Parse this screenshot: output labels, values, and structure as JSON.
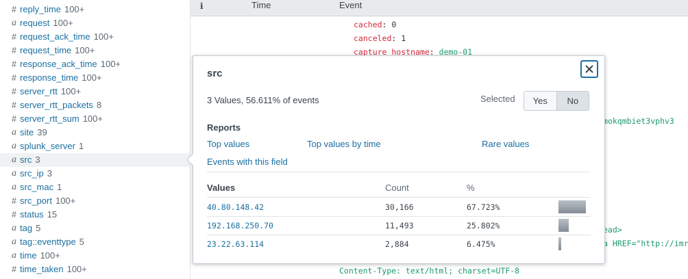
{
  "sidebar": {
    "fields": [
      {
        "type": "#",
        "name": "reply_time",
        "count": "100+"
      },
      {
        "type": "a",
        "name": "request",
        "count": "100+"
      },
      {
        "type": "#",
        "name": "request_ack_time",
        "count": "100+"
      },
      {
        "type": "#",
        "name": "request_time",
        "count": "100+"
      },
      {
        "type": "#",
        "name": "response_ack_time",
        "count": "100+"
      },
      {
        "type": "#",
        "name": "response_time",
        "count": "100+"
      },
      {
        "type": "#",
        "name": "server_rtt",
        "count": "100+"
      },
      {
        "type": "#",
        "name": "server_rtt_packets",
        "count": "8"
      },
      {
        "type": "#",
        "name": "server_rtt_sum",
        "count": "100+"
      },
      {
        "type": "a",
        "name": "site",
        "count": "39"
      },
      {
        "type": "a",
        "name": "splunk_server",
        "count": "1"
      },
      {
        "type": "a",
        "name": "src",
        "count": "3",
        "selected": true
      },
      {
        "type": "a",
        "name": "src_ip",
        "count": "3"
      },
      {
        "type": "a",
        "name": "src_mac",
        "count": "1"
      },
      {
        "type": "#",
        "name": "src_port",
        "count": "100+"
      },
      {
        "type": "#",
        "name": "status",
        "count": "15"
      },
      {
        "type": "a",
        "name": "tag",
        "count": "5"
      },
      {
        "type": "a",
        "name": "tag::eventtype",
        "count": "5"
      },
      {
        "type": "a",
        "name": "time",
        "count": "100+"
      },
      {
        "type": "#",
        "name": "time_taken",
        "count": "100+"
      }
    ]
  },
  "events": {
    "header": {
      "info": "i",
      "time": "Time",
      "event": "Event"
    },
    "lines": {
      "cached_key": "cached",
      "cached_val": "0",
      "canceled_key": "canceled",
      "canceled_val": "1",
      "capture_key": "capture_hostname",
      "capture_val": "demo-01",
      "partial_right": "mokqmbiet3vphv3",
      "partial_ead": "ead>",
      "partial_href": "a HREF=\"http://imr",
      "content_type": "Content-Type: text/html; charset=UTF-8"
    }
  },
  "popup": {
    "title": "src",
    "summary": "3 Values, 56.611% of events",
    "selected_label": "Selected",
    "toggle": {
      "yes": "Yes",
      "no": "No",
      "active": "No"
    },
    "reports_title": "Reports",
    "reports": {
      "top_values": "Top values",
      "top_values_by_time": "Top values by time",
      "rare_values": "Rare values",
      "events_with_field": "Events with this field"
    },
    "table": {
      "headers": {
        "values": "Values",
        "count": "Count",
        "percent": "%"
      },
      "rows": [
        {
          "value": "40.80.148.42",
          "count": "30,166",
          "percent": "67.723%",
          "fraction": 0.67723
        },
        {
          "value": "192.168.250.70",
          "count": "11,493",
          "percent": "25.802%",
          "fraction": 0.25802
        },
        {
          "value": "23.22.63.114",
          "count": "2,884",
          "percent": "6.475%",
          "fraction": 0.06475
        }
      ]
    }
  },
  "colors": {
    "link": "#1a6fa0",
    "key": "#d6273b",
    "green_value": "#1c9a6b"
  }
}
